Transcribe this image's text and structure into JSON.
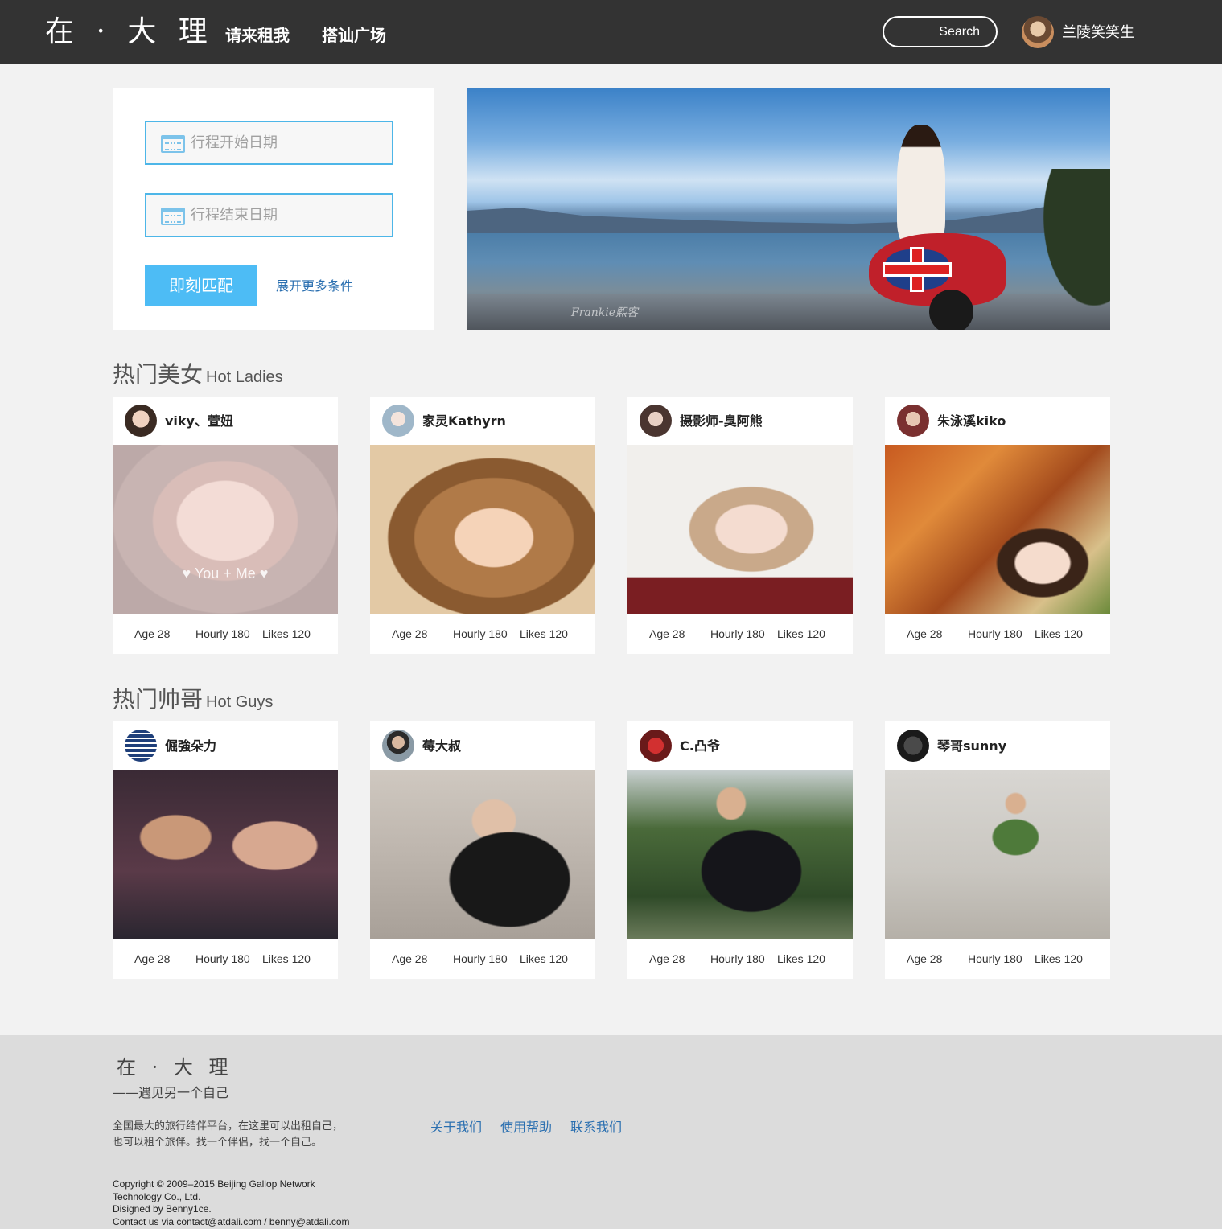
{
  "header": {
    "logo": "在 · 大 理",
    "nav": [
      "请来租我",
      "搭讪广场"
    ],
    "search_label": "Search",
    "user_name": "兰陵笑笑生"
  },
  "search_panel": {
    "start_placeholder": "行程开始日期",
    "end_placeholder": "行程结束日期",
    "match_button": "即刻匹配",
    "more_link": "展开更多条件"
  },
  "banner": {
    "watermark": "Frankie熙客"
  },
  "hot_ladies": {
    "title_zh": "热门美女",
    "title_en": "Hot Ladies",
    "cards": [
      {
        "name": "viky、萱妞",
        "age": "Age 28",
        "hourly": "Hourly 180",
        "likes": "Likes 120",
        "overlay": "♥   You  +  Me   ♥"
      },
      {
        "name": "家灵Kathyrn",
        "age": "Age 28",
        "hourly": "Hourly 180",
        "likes": "Likes 120"
      },
      {
        "name": "摄影师-臭阿熊",
        "age": "Age 28",
        "hourly": "Hourly 180",
        "likes": "Likes 120"
      },
      {
        "name": "朱泳溪kiko",
        "age": "Age 28",
        "hourly": "Hourly 180",
        "likes": "Likes 120"
      }
    ]
  },
  "hot_guys": {
    "title_zh": "热门帅哥",
    "title_en": "Hot Guys",
    "cards": [
      {
        "name": "倔強朵力",
        "age": "Age 28",
        "hourly": "Hourly 180",
        "likes": "Likes 120"
      },
      {
        "name": "莓大叔",
        "age": "Age 28",
        "hourly": "Hourly 180",
        "likes": "Likes 120"
      },
      {
        "name": "C.凸爷",
        "age": "Age 28",
        "hourly": "Hourly 180",
        "likes": "Likes 120"
      },
      {
        "name": "琴哥sunny",
        "age": "Age 28",
        "hourly": "Hourly 180",
        "likes": "Likes 120"
      }
    ]
  },
  "footer": {
    "logo": "在 · 大 理",
    "slogan": "——遇见另一个自己",
    "description": "全国最大的旅行结伴平台，在这里可以出租自己，也可以租个旅伴。找一个伴侣，找一个自己。",
    "copyright": "Copyright © 2009–2015 Beijing Gallop Network Technology Co., Ltd.",
    "designed_by": "Disigned by Benny1ce.",
    "contact": "Contact us via contact@atdali.com / benny@atdali.com",
    "links": [
      "关于我们",
      "使用帮助",
      "联系我们"
    ]
  }
}
